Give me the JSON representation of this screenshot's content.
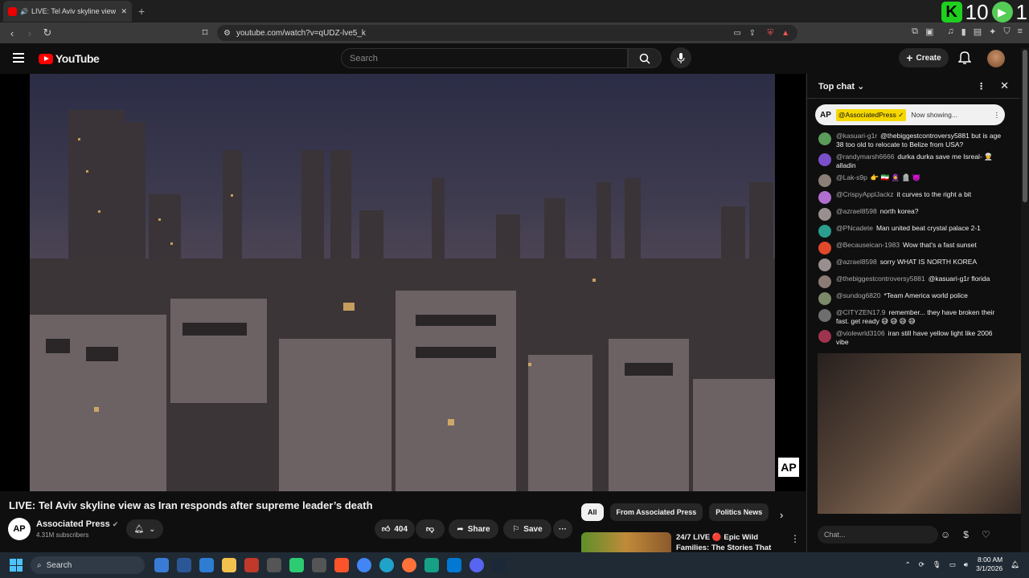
{
  "browser": {
    "tab_title": "LIVE: Tel Aviv skyline view as I",
    "new_tab": "+",
    "url": "youtube.com/watch?v=qUDZ-lve5_k",
    "overlay_numbers": "10",
    "overlay_number_right": "1"
  },
  "header": {
    "logo_text": "YouTube",
    "search_placeholder": "Search",
    "create_label": "Create"
  },
  "video": {
    "watermark": "AP",
    "title": "LIVE: Tel Aviv skyline view as Iran responds after supreme leader’s death",
    "channel_avatar": "AP",
    "channel_name": "Associated Press",
    "subscribers": "4.31M subscribers",
    "likes": "404",
    "share_label": "Share",
    "save_label": "Save",
    "more": "···"
  },
  "chips": [
    "All",
    "From Associated Press",
    "Politics News"
  ],
  "recommendation": {
    "title": "24/7 LIVE 🔴 Epic Wild Families: The Stories That ..."
  },
  "chat": {
    "mode": "Top chat",
    "pinned_author": "@AssociatedPress",
    "pinned_text": "Now showing...",
    "pinned_avatar": "AP",
    "input_placeholder": "Chat...",
    "messages": [
      {
        "author": "@kasuari-g1r",
        "text": "@thebiggestcontroversy5881 but is age 38 too old to relocate to Belize from USA?",
        "color": "#5a9c5a"
      },
      {
        "author": "@randymarsh6666",
        "text": "durka durka save me Isreal- 👳 alladin",
        "color": "#7b4fc9"
      },
      {
        "author": "@Lak-s9p",
        "text": "👉 🇮🇷 🧕 🪦 👿",
        "color": "#8a7f77"
      },
      {
        "author": "@CrispyApplJackz",
        "text": "it curves to the right a bit",
        "color": "#b06fd0"
      },
      {
        "author": "@azrael8598",
        "text": "north korea?",
        "color": "#9a8f8f"
      },
      {
        "author": "@PNcadete",
        "text": "Man united beat crystal palace 2-1",
        "color": "#2a9d8f"
      },
      {
        "author": "@Becauseican-1983",
        "text": "Wow that's a fast sunset",
        "color": "#e04a2a"
      },
      {
        "author": "@azrael8598",
        "text": "sorry WHAT IS NORTH KOREA",
        "color": "#9a8f8f"
      },
      {
        "author": "@thebiggestcontroversy5881",
        "text": "@kasuari-g1r florida",
        "color": "#8c7b74"
      },
      {
        "author": "@sundog6820",
        "text": "*Team America world police",
        "color": "#7d8a6a"
      },
      {
        "author": "@CITYZEN17.9",
        "text": "remember... they have broken their fast. get ready 😅 😅 😅 😅",
        "color": "#6e6e6e"
      },
      {
        "author": "@violewrld3106",
        "text": "iran still have yellow light like 2006 vibe",
        "color": "#a0334e"
      }
    ]
  },
  "taskbar": {
    "search_label": "Search",
    "time": "8:00 AM",
    "date": "3/1/2026"
  }
}
